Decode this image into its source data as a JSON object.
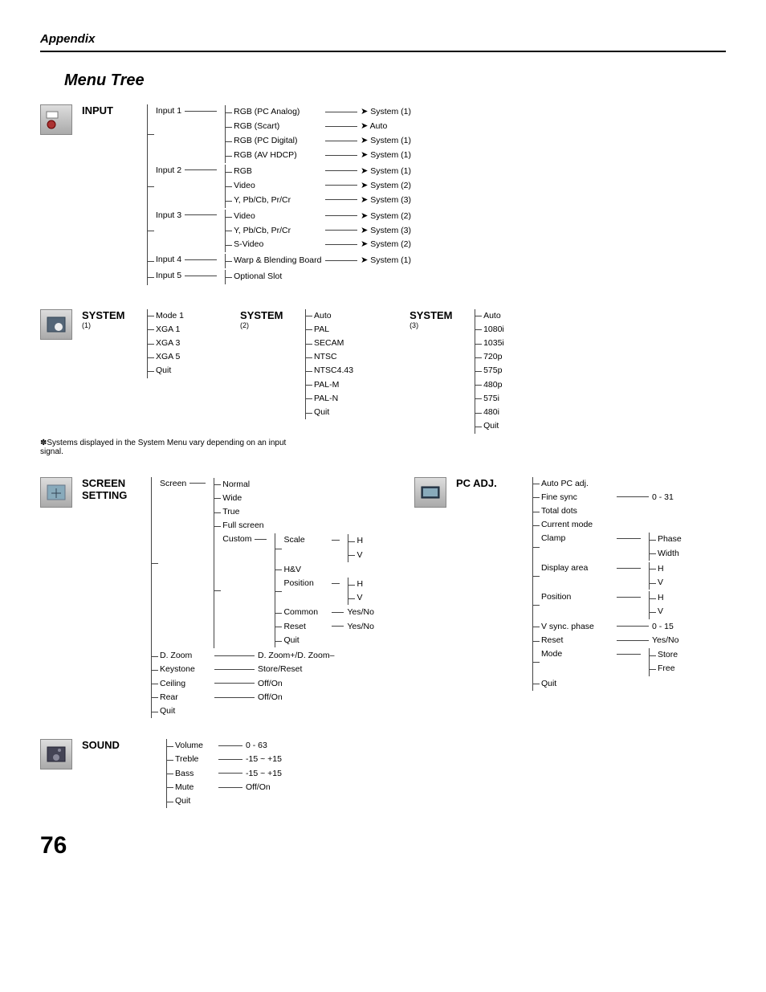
{
  "header": "Appendix",
  "title": "Menu Tree",
  "page_number": "76",
  "note": "✽Systems displayed in the System Menu vary depending on an input signal.",
  "input": {
    "label": "INPUT",
    "rows": [
      {
        "name": "Input 1",
        "children": [
          {
            "name": "RGB (PC Analog)",
            "target": "System (1)"
          },
          {
            "name": "RGB (Scart)",
            "target": "Auto"
          },
          {
            "name": "RGB (PC Digital)",
            "target": "System (1)"
          },
          {
            "name": "RGB (AV HDCP)",
            "target": "System (1)"
          }
        ]
      },
      {
        "name": "Input 2",
        "children": [
          {
            "name": "RGB",
            "target": "System (1)"
          },
          {
            "name": "Video",
            "target": "System (2)"
          },
          {
            "name": "Y, Pb/Cb, Pr/Cr",
            "target": "System (3)"
          }
        ]
      },
      {
        "name": "Input 3",
        "children": [
          {
            "name": "Video",
            "target": "System (2)"
          },
          {
            "name": "Y, Pb/Cb, Pr/Cr",
            "target": "System (3)"
          },
          {
            "name": "S-Video",
            "target": "System (2)"
          }
        ]
      },
      {
        "name": "Input 4",
        "children": [
          {
            "name": "Warp & Blending Board",
            "target": "System (1)"
          }
        ]
      },
      {
        "name": "Input 5",
        "children": [
          {
            "name": "Optional Slot",
            "target": ""
          }
        ]
      }
    ]
  },
  "system1": {
    "label": "SYSTEM",
    "sub": "(1)",
    "items": [
      "Mode 1",
      "XGA 1",
      "XGA 3",
      "XGA 5",
      "Quit"
    ]
  },
  "system2": {
    "label": "SYSTEM",
    "sub": "(2)",
    "items": [
      "Auto",
      "PAL",
      "SECAM",
      "NTSC",
      "NTSC4.43",
      "PAL-M",
      "PAL-N",
      "Quit"
    ]
  },
  "system3": {
    "label": "SYSTEM",
    "sub": "(3)",
    "items": [
      "Auto",
      "1080i",
      "1035i",
      "720p",
      "575p",
      "480p",
      "575i",
      "480i",
      "Quit"
    ]
  },
  "screen": {
    "label": "SCREEN SETTING",
    "screen_item": "Screen",
    "screen_children": [
      "Normal",
      "Wide",
      "True",
      "Full screen"
    ],
    "custom": "Custom",
    "custom_children": [
      {
        "name": "Scale",
        "sub": [
          "H",
          "V"
        ]
      },
      {
        "name": "H&V"
      },
      {
        "name": "Position",
        "sub": [
          "H",
          "V"
        ]
      },
      {
        "name": "Common",
        "val": "Yes/No"
      },
      {
        "name": "Reset",
        "val": "Yes/No"
      },
      {
        "name": "Quit"
      }
    ],
    "others": [
      {
        "name": "D. Zoom",
        "val": "D. Zoom+/D. Zoom–"
      },
      {
        "name": "Keystone",
        "val": "Store/Reset"
      },
      {
        "name": "Ceiling",
        "val": "Off/On"
      },
      {
        "name": "Rear",
        "val": "Off/On"
      },
      {
        "name": "Quit"
      }
    ]
  },
  "pcadj": {
    "label": "PC ADJ.",
    "items": [
      {
        "name": "Auto PC adj."
      },
      {
        "name": "Fine sync",
        "val": "0 - 31"
      },
      {
        "name": "Total dots"
      },
      {
        "name": "Current mode"
      },
      {
        "name": "Clamp",
        "sub": [
          "Phase",
          "Width"
        ]
      },
      {
        "name": "Display area",
        "sub": [
          "H",
          "V"
        ]
      },
      {
        "name": "Position",
        "sub": [
          "H",
          "V"
        ]
      },
      {
        "name": "V sync. phase",
        "val": "0  - 15"
      },
      {
        "name": "Reset",
        "val": "Yes/No"
      },
      {
        "name": "Mode",
        "sub": [
          "Store",
          "Free"
        ]
      },
      {
        "name": "Quit"
      }
    ]
  },
  "sound": {
    "label": "SOUND",
    "items": [
      {
        "name": "Volume",
        "val": "0 - 63"
      },
      {
        "name": "Treble",
        "val": "-15 ~ +15"
      },
      {
        "name": "Bass",
        "val": "-15 ~ +15"
      },
      {
        "name": "Mute",
        "val": "Off/On"
      },
      {
        "name": "Quit"
      }
    ]
  }
}
